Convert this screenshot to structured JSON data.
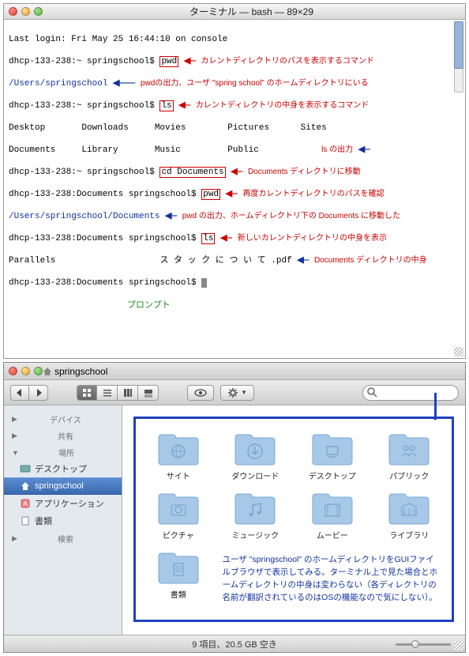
{
  "terminal": {
    "title": "ターミナル — bash — 89×29",
    "lines": {
      "l1": "Last login: Fri May 25 16:44:10 on console",
      "l2p": "dhcp-133-238:~ springschool$ ",
      "l2cmd": "pwd",
      "l2note": "カレントディレクトリのパスを表示するコマンド",
      "l3out": "/Users/springschool",
      "l3note": "pwdの出力、ユーザ \"spring school\" のホームディレクトリにいる",
      "l4p": "dhcp-133-238:~ springschool$ ",
      "l4cmd": "ls",
      "l4note": "カレントディレクトリの中身を表示するコマンド",
      "ls_row1": "Desktop       Downloads     Movies        Pictures      Sites",
      "ls_row2": "Documents     Library       Music         Public",
      "ls_out_note": "ls の出力",
      "l6p": "dhcp-133-238:~ springschool$ ",
      "l6cmd": "cd Documents",
      "l6note": "Documents ディレクトリに移動",
      "l7p": "dhcp-133-238:Documents springschool$ ",
      "l7cmd": "pwd",
      "l7note": "再度カレントディレクトリのパスを確認",
      "l8out": "/Users/springschool/Documents",
      "l8note": "pwd の出力、ホームディレクトリ下の Documents に移動した",
      "l9p": "dhcp-133-238:Documents springschool$ ",
      "l9cmd": "ls",
      "l9note": "新しいカレントディレクトリの中身を表示",
      "l10a": "Parallels",
      "l10b": "ス タ ッ ク に つ い て .pdf",
      "l10note": "Documents ディレクトリの中身",
      "l11p": "dhcp-133-238:Documents springschool$ ",
      "prompt_note": "プロンプト"
    }
  },
  "finder": {
    "title": "springschool",
    "search_placeholder": "",
    "sidebar": {
      "devices": "デバイス",
      "shared": "共有",
      "places": "場所",
      "search_hdr": "検索",
      "items": {
        "desktop": "デスクトップ",
        "home": "springschool",
        "apps": "アプリケーション",
        "docs": "書類"
      }
    },
    "folders": {
      "sites": "サイト",
      "downloads": "ダウンロード",
      "desktop": "デスクトップ",
      "public": "パブリック",
      "pictures": "ピクチャ",
      "music": "ミュージック",
      "movies": "ムービー",
      "library": "ライブラリ",
      "documents": "書類"
    },
    "explain": "ユーザ \"springschool\" のホームディレクトリをGUIファイルブラウザで表示してみる。ターミナル上で見た場合とホームディレクトリの中身は変わらない（各ディレクトリの名前が翻訳されているのはOSの機能なので気にしない）。",
    "status": "9 項目、20.5 GB 空き"
  }
}
